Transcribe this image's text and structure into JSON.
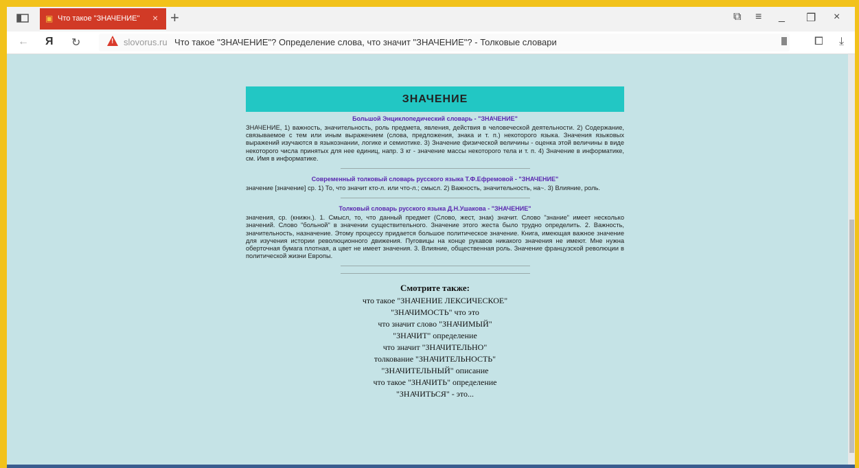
{
  "browser": {
    "tab_title": "Что такое \"ЗНАЧЕНИЕ\"",
    "domain": "slovorus.ru",
    "page_title": "Что такое \"ЗНАЧЕНИЕ\"? Определение слова, что значит \"ЗНАЧЕНИЕ\"? - Толковые словари",
    "yandex_letter": "Я"
  },
  "article": {
    "heading": "ЗНАЧЕНИЕ",
    "sections": [
      {
        "source": "Большой Энциклопедический словарь - \"ЗНАЧЕНИЕ\"",
        "text": "ЗНАЧЕНИЕ, 1) важность, значительность, роль предмета, явления, действия в человеческой деятельности. 2) Содержание, связываемое с тем или иным выражением (слова, предложения, знака и т. п.) некоторого языка. Значения языковых выражений изучаются в языкознании, логике и семиотике. 3) Значение физической величины - оценка этой величины в виде некоторого числа принятых для нее единиц, напр. 3 кг - значение массы некоторого тела и т. п. 4) Значение в информатике, см. Имя в информатике."
      },
      {
        "source": "Современный толковый словарь русского языка Т.Ф.Ефремовой - \"ЗНАЧЕНИЕ\"",
        "text": "значение [значение] ср. 1) То, что значит кто-л. или что-л.; смысл. 2) Важность, значительность, на~. 3) Влияние, роль."
      },
      {
        "source": "Толковый словарь русского языка Д.Н.Ушакова - \"ЗНАЧЕНИЕ\"",
        "text": "значения, ср. (книжн.). 1. Смысл, то, что данный предмет (Слово, жест, знак) значит. Слово \"знание\" имеет несколько значений. Слово \"больной\" в значении существительного. Значение этого жеста было трудно определить. 2. Важность, значительность, назначение. Этому процессу придается большое политическое значение. Книга, имеющая важное значение для изучения истории революционного движения. Пуговицы на конце рукавов никакого значения не имеют. Мне нужна оберточная бумага плотная, а цвет не имеет значения. 3. Влияние, общественная роль. Значение французской революции в политической жизни Европы."
      }
    ]
  },
  "see_also": {
    "heading": "Смотрите также:",
    "items": [
      "что такое \"ЗНАЧЕНИЕ ЛЕКСИЧЕСКОЕ\"",
      "\"ЗНАЧИМОСТЬ\" что это",
      "что значит слово \"ЗНАЧИМЫЙ\"",
      "\"ЗНАЧИТ\" определение",
      "что значит \"ЗНАЧИТЕЛЬНО\"",
      "толкование \"ЗНАЧИТЕЛЬНОСТЬ\"",
      "\"ЗНАЧИТЕЛЬНЫЙ\" описание",
      "что такое \"ЗНАЧИТЬ\" определение",
      "\"ЗНАЧИТЬСЯ\" - это..."
    ]
  }
}
